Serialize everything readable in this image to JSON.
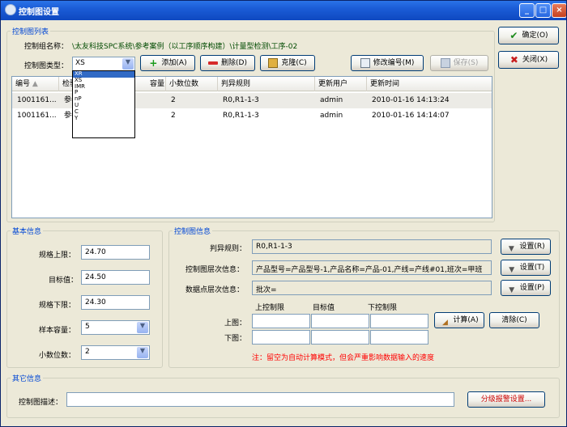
{
  "window": {
    "title": "控制图设置"
  },
  "list_group": {
    "caption": "控制图列表",
    "name_label": "控制组名称：",
    "name_value": "\\太友科技SPC系统\\参考案例（以工序顺序构建）\\计量型检测\\工序-02",
    "type_label": "控制图类型：",
    "type_value": "XS",
    "type_options": [
      "XR",
      "XS",
      "IMR",
      "P",
      "nP",
      "U",
      "C",
      "Y"
    ],
    "add_label": "添加(A)",
    "delete_label": "删除(D)",
    "clone_label": "克隆(C)",
    "edit_number_label": "修改编号(M)",
    "save_label": "保存(S)"
  },
  "table": {
    "columns": [
      "编号",
      "检验",
      "容量",
      "小数位数",
      "判异规则",
      "更新用户",
      "更新时间"
    ],
    "rows": [
      {
        "id": "1001161...",
        "check": "参考",
        "count": "",
        "decimals": "2",
        "rule": "R0,R1-1-3",
        "user": "admin",
        "time": "2010-01-16 14:13:24"
      },
      {
        "id": "1001161...",
        "check": "参考",
        "count": "",
        "decimals": "2",
        "rule": "R0,R1-1-3",
        "user": "admin",
        "time": "2010-01-16 14:14:07"
      }
    ]
  },
  "side": {
    "ok_label": "确定(O)",
    "close_label": "关闭(X)"
  },
  "basic": {
    "caption": "基本信息",
    "usl_label": "规格上限：",
    "usl": "24.70",
    "target_label": "目标值：",
    "target": "24.50",
    "lsl_label": "规格下限：",
    "lsl": "24.30",
    "sample_label": "样本容量：",
    "sample": "5",
    "decimals_label": "小数位数：",
    "decimals": "2"
  },
  "chart_info": {
    "caption": "控制图信息",
    "rule_label": "判异规则：",
    "rule": "R0,R1-1-3",
    "layer_label": "控制图层次信息：",
    "layer": "产品型号=产品型号-1,产品名称=产品-01,产线=产线#01,班次=甲班",
    "point_label": "数据点层次信息：",
    "point": "批次=",
    "set_r": "设置(R)",
    "set_t": "设置(T)",
    "set_p": "设置(P)",
    "col_ucl": "上控制限",
    "col_target": "目标值",
    "col_lcl": "下控制限",
    "upper_label": "上图：",
    "lower_label": "下图：",
    "calc_label": "计算(A)",
    "clear_label": "清除(C)",
    "note": "注：留空为自动计算模式，但会严重影响数据输入的速度"
  },
  "other": {
    "caption": "其它信息",
    "desc_label": "控制图描述：",
    "desc": "",
    "alarm_label": "分级报警设置..."
  },
  "colors": {
    "caption": "#0046d5",
    "note": "#ff0000",
    "title_bar": "#0e48c0"
  }
}
